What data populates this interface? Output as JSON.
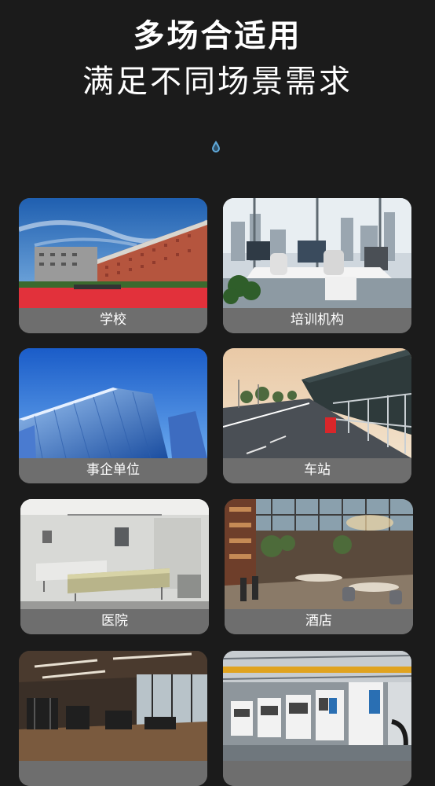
{
  "hero": {
    "title_line1": "多场合适用",
    "title_line2": "满足不同场景需求",
    "drop_icon": "water-drop-icon"
  },
  "scenes": [
    {
      "label": "学校",
      "image": "school-building-photo"
    },
    {
      "label": "培训机构",
      "image": "training-office-photo"
    },
    {
      "label": "事企单位",
      "image": "glass-skyscraper-photo"
    },
    {
      "label": "车站",
      "image": "station-platform-photo"
    },
    {
      "label": "医院",
      "image": "hospital-ward-photo"
    },
    {
      "label": "酒店",
      "image": "hotel-restaurant-photo"
    },
    {
      "label": "",
      "image": "gym-photo"
    },
    {
      "label": "",
      "image": "factory-photo"
    }
  ],
  "colors": {
    "background": "#1b1b1b",
    "label_bar": "#6e6e6e",
    "drop_accent": "#5fa8d8"
  }
}
